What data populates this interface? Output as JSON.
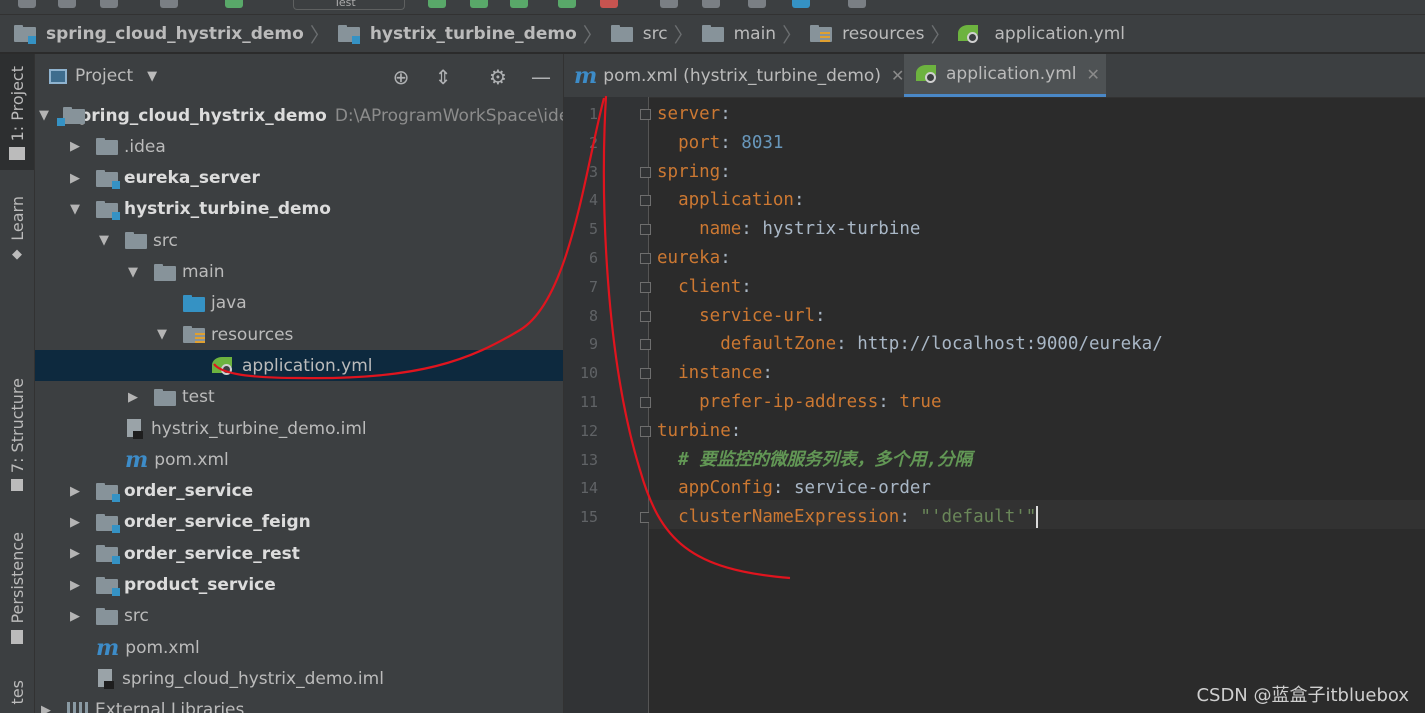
{
  "toolbar": {
    "run_config": "Test"
  },
  "breadcrumb": [
    {
      "label": "spring_cloud_hystrix_demo",
      "icon": "module-folder-icon",
      "bold": true
    },
    {
      "label": "hystrix_turbine_demo",
      "icon": "module-folder-icon",
      "bold": true
    },
    {
      "label": "src",
      "icon": "folder-icon",
      "bold": false
    },
    {
      "label": "main",
      "icon": "folder-icon",
      "bold": false
    },
    {
      "label": "resources",
      "icon": "resources-folder-icon",
      "bold": false
    },
    {
      "label": "application.yml",
      "icon": "spring-config-icon",
      "bold": false
    }
  ],
  "left_strip": {
    "project": "1: Project",
    "learn": "Learn",
    "structure": "7: Structure",
    "persistence": "Persistence",
    "favorites": "tes"
  },
  "project_panel": {
    "title": "Project",
    "tree": [
      {
        "label": "spring_cloud_hystrix_demo",
        "path": "D:\\AProgramWorkSpace\\ide",
        "depth": 0,
        "arrow": "down",
        "icon": "module",
        "bold": true
      },
      {
        "label": ".idea",
        "depth": 1,
        "arrow": "right",
        "icon": "folder",
        "bold": false
      },
      {
        "label": "eureka_server",
        "depth": 1,
        "arrow": "right",
        "icon": "module",
        "bold": true
      },
      {
        "label": "hystrix_turbine_demo",
        "depth": 1,
        "arrow": "down",
        "icon": "module",
        "bold": true
      },
      {
        "label": "src",
        "depth": 2,
        "arrow": "down",
        "icon": "folder",
        "bold": false
      },
      {
        "label": "main",
        "depth": 3,
        "arrow": "down",
        "icon": "folder",
        "bold": false
      },
      {
        "label": "java",
        "depth": 4,
        "arrow": "none",
        "icon": "blue",
        "bold": false
      },
      {
        "label": "resources",
        "depth": 4,
        "arrow": "down",
        "icon": "res",
        "bold": false
      },
      {
        "label": "application.yml",
        "depth": 5,
        "arrow": "none",
        "icon": "spring",
        "bold": false,
        "selected": true
      },
      {
        "label": "test",
        "depth": 3,
        "arrow": "right",
        "icon": "folder",
        "bold": false
      },
      {
        "label": "hystrix_turbine_demo.iml",
        "depth": 2,
        "arrow": "none",
        "icon": "iml",
        "bold": false
      },
      {
        "label": "pom.xml",
        "depth": 2,
        "arrow": "none",
        "icon": "maven",
        "bold": false
      },
      {
        "label": "order_service",
        "depth": 1,
        "arrow": "right",
        "icon": "module",
        "bold": true
      },
      {
        "label": "order_service_feign",
        "depth": 1,
        "arrow": "right",
        "icon": "module",
        "bold": true
      },
      {
        "label": "order_service_rest",
        "depth": 1,
        "arrow": "right",
        "icon": "module",
        "bold": true
      },
      {
        "label": "product_service",
        "depth": 1,
        "arrow": "right",
        "icon": "module",
        "bold": true
      },
      {
        "label": "src",
        "depth": 1,
        "arrow": "right",
        "icon": "folder",
        "bold": false
      },
      {
        "label": "pom.xml",
        "depth": 1,
        "arrow": "none",
        "icon": "maven",
        "bold": false
      },
      {
        "label": "spring_cloud_hystrix_demo.iml",
        "depth": 1,
        "arrow": "none",
        "icon": "iml",
        "bold": false
      },
      {
        "label": "External Libraries",
        "depth": 0,
        "arrow": "right",
        "icon": "libs",
        "bold": false
      }
    ]
  },
  "editor_tabs": [
    {
      "label": "pom.xml (hystrix_turbine_demo)",
      "icon": "maven",
      "active": false
    },
    {
      "label": "application.yml",
      "icon": "spring",
      "active": true
    }
  ],
  "code": {
    "line_numbers": [
      "1",
      "2",
      "3",
      "4",
      "5",
      "6",
      "7",
      "8",
      "9",
      "10",
      "11",
      "12",
      "13",
      "14",
      "15"
    ],
    "lines": [
      [
        {
          "t": "server",
          "c": "k"
        },
        {
          "t": ":",
          "c": ""
        }
      ],
      [
        {
          "t": "  port",
          "c": "k"
        },
        {
          "t": ": ",
          "c": ""
        },
        {
          "t": "8031",
          "c": "n"
        }
      ],
      [
        {
          "t": "spring",
          "c": "k"
        },
        {
          "t": ":",
          "c": ""
        }
      ],
      [
        {
          "t": "  application",
          "c": "k"
        },
        {
          "t": ":",
          "c": ""
        }
      ],
      [
        {
          "t": "    name",
          "c": "k"
        },
        {
          "t": ": hystrix-turbine",
          "c": ""
        }
      ],
      [
        {
          "t": "eureka",
          "c": "k"
        },
        {
          "t": ":",
          "c": ""
        }
      ],
      [
        {
          "t": "  client",
          "c": "k"
        },
        {
          "t": ":",
          "c": ""
        }
      ],
      [
        {
          "t": "    service-url",
          "c": "k"
        },
        {
          "t": ":",
          "c": ""
        }
      ],
      [
        {
          "t": "      defaultZone",
          "c": "k"
        },
        {
          "t": ": http://localhost:9000/eureka/",
          "c": ""
        }
      ],
      [
        {
          "t": "  instance",
          "c": "k"
        },
        {
          "t": ":",
          "c": ""
        }
      ],
      [
        {
          "t": "    prefer-ip-address",
          "c": "k"
        },
        {
          "t": ": ",
          "c": ""
        },
        {
          "t": "true",
          "c": "k"
        }
      ],
      [
        {
          "t": "turbine",
          "c": "k"
        },
        {
          "t": ":",
          "c": ""
        }
      ],
      [
        {
          "t": "  # 要监控的微服务列表，多个用,分隔",
          "c": "c"
        }
      ],
      [
        {
          "t": "  appConfig",
          "c": "k"
        },
        {
          "t": ": service-order",
          "c": ""
        }
      ],
      [
        {
          "t": "  clusterNameExpression",
          "c": "k"
        },
        {
          "t": ": ",
          "c": ""
        },
        {
          "t": "\"'default'\"",
          "c": "s"
        }
      ]
    ]
  },
  "watermark": "CSDN @蓝盒子itbluebox"
}
